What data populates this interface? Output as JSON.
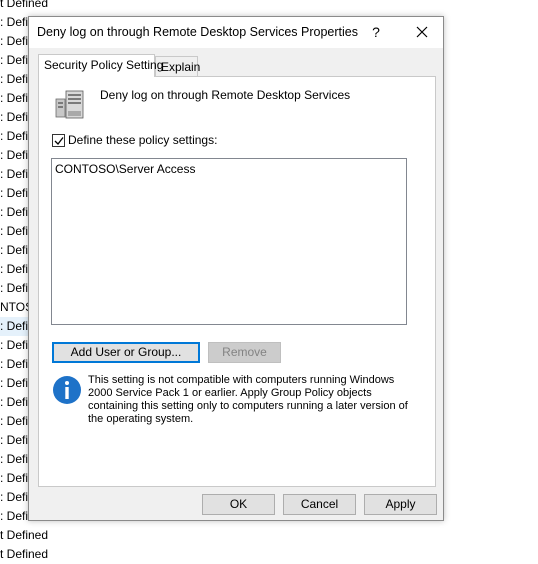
{
  "background_list": {
    "rows": [
      "t Defined",
      ": Defin",
      ": Defin",
      ": Defin",
      ": Defin",
      ": Defin",
      ": Defin",
      ": Defin",
      ": Defin",
      ": Defin",
      ": Defin",
      ": Defin",
      ": Defin",
      ": Defin",
      ": Defin",
      ": Defin",
      "NTOS",
      ": Defin",
      ": Defin",
      ": Defin",
      ": Defin",
      ": Defin",
      ": Defin",
      ": Defin",
      ": Defin",
      ": Defin",
      ": Defin",
      ": Defin",
      "t Defined",
      "t Defined"
    ]
  },
  "dialog": {
    "title": "Deny log on through Remote Desktop Services Properties",
    "help_label": "?",
    "tabs": [
      {
        "label": "Security Policy Setting",
        "active": true
      },
      {
        "label": "Explain",
        "active": false
      }
    ],
    "policy_name": "Deny log on through Remote Desktop Services",
    "define_checkbox": {
      "label": "Define these policy settings:",
      "checked": true
    },
    "accounts": [
      "CONTOSO\\Server Access"
    ],
    "add_button": "Add User or Group...",
    "remove_button": "Remove",
    "info_text": "This setting is not compatible with computers running Windows 2000 Service Pack 1 or earlier.  Apply Group Policy objects containing this setting only to computers running a later version of the operating system.",
    "ok_button": "OK",
    "cancel_button": "Cancel",
    "apply_button": "Apply"
  },
  "icons": {
    "policy": "server-policy-icon",
    "info": "info-icon",
    "close": "close-icon"
  },
  "colors": {
    "info_blue": "#1e72c8",
    "selection_row": "#e5f1fb",
    "default_button_border": "#0078d7"
  }
}
